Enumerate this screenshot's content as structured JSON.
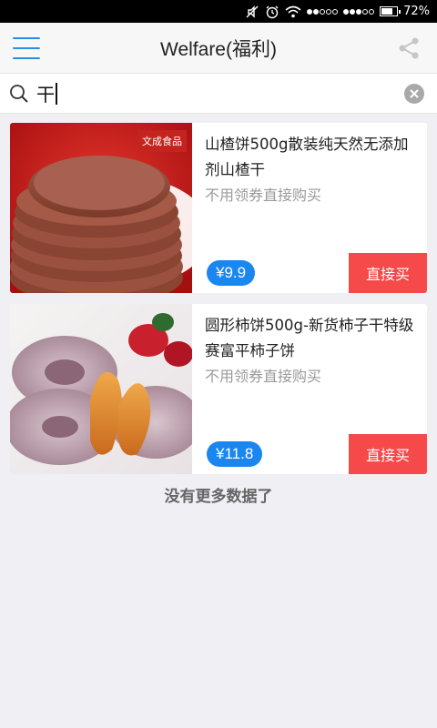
{
  "status_bar": {
    "battery": "72%"
  },
  "header": {
    "title": "Welfare(福利)"
  },
  "search": {
    "value": "干"
  },
  "products": [
    {
      "name": "山楂饼500g散装纯天然无添加剂山楂干",
      "note": "不用领券直接购买",
      "price": "¥9.9",
      "buy_label": "直接买",
      "brand_text": "文成食品"
    },
    {
      "name": "圆形柿饼500g-新货柿子干特级 赛富平柿子饼",
      "note": "不用领券直接购买",
      "price": "¥11.8",
      "buy_label": "直接买"
    }
  ],
  "footer_text": "没有更多数据了",
  "colors": {
    "accent": "#1a86f0",
    "buy": "#f5494a",
    "menu": "#2b8ee6"
  }
}
